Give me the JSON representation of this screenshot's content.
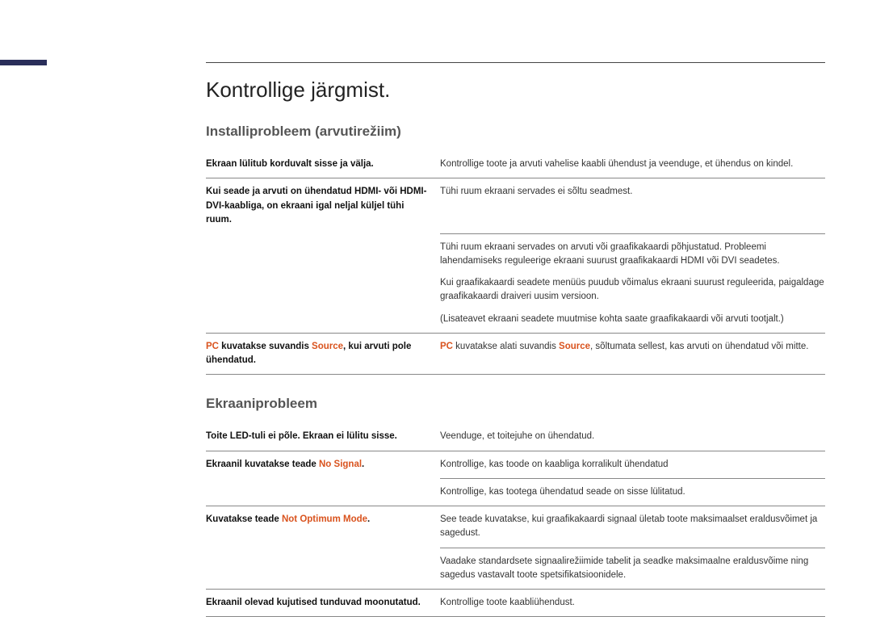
{
  "title": "Kontrollige järgmist.",
  "sections": [
    {
      "heading": "Installiprobleem (arvutirežiim)",
      "rows": [
        {
          "left_plain": "Ekraan lülitub korduvalt sisse ja välja.",
          "right_plain": "Kontrollige toote ja arvuti vahelise kaabli ühendust ja veenduge, et ühendus on kindel.",
          "sep": "both"
        },
        {
          "left_plain": "Kui seade ja arvuti on ühendatud HDMI- või HDMI-DVI-kaabliga, on ekraani igal neljal küljel tühi ruum.",
          "right_plain": "Tühi ruum ekraani servades ei sõltu seadmest.",
          "sep": "right"
        },
        {
          "left_plain": "",
          "right_paras": [
            "Tühi ruum ekraani servades on arvuti või graafikakaardi põhjustatud. Probleemi lahendamiseks reguleerige ekraani suurust graafikakaardi HDMI või DVI seadetes.",
            "Kui graafikakaardi seadete menüüs puudub võimalus ekraani suurust reguleerida, paigaldage graafikakaardi draiveri uusim versioon.",
            "(Lisateavet ekraani seadete muutmise kohta saate graafikakaardi või arvuti tootjalt.)"
          ],
          "sep": "both"
        },
        {
          "left_parts": [
            {
              "t": "PC",
              "hl": true
            },
            {
              "t": " kuvatakse suvandis "
            },
            {
              "t": "Source",
              "hl": true
            },
            {
              "t": ", kui arvuti pole ühendatud."
            }
          ],
          "right_parts": [
            {
              "t": "PC",
              "hl": true
            },
            {
              "t": " kuvatakse alati suvandis "
            },
            {
              "t": "Source",
              "hl": true
            },
            {
              "t": ", sõltumata sellest, kas arvuti on ühendatud või mitte."
            }
          ],
          "sep": "both"
        }
      ]
    },
    {
      "heading": "Ekraaniprobleem",
      "rows": [
        {
          "left_plain": "Toite LED-tuli ei põle. Ekraan ei lülitu sisse.",
          "right_plain": "Veenduge, et toitejuhe on ühendatud.",
          "sep": "both"
        },
        {
          "left_parts": [
            {
              "t": "Ekraanil kuvatakse teade "
            },
            {
              "t": "No Signal",
              "hl": true
            },
            {
              "t": "."
            }
          ],
          "right_plain": "Kontrollige, kas toode on kaabliga korralikult ühendatud",
          "sep": "right"
        },
        {
          "left_plain": "",
          "right_plain": "Kontrollige, kas tootega ühendatud seade on sisse lülitatud.",
          "sep": "both"
        },
        {
          "left_parts": [
            {
              "t": "Kuvatakse teade "
            },
            {
              "t": "Not Optimum Mode",
              "hl": true
            },
            {
              "t": "."
            }
          ],
          "right_plain": "See teade kuvatakse, kui graafikakaardi signaal ületab toote maksimaalset eraldusvõimet ja sagedust.",
          "sep": "right"
        },
        {
          "left_plain": "",
          "right_plain": "Vaadake standardsete signaalirežiimide tabelit ja seadke maksimaalne eraldusvõime ning sagedus vastavalt toote spetsifikatsioonidele.",
          "sep": "both"
        },
        {
          "left_plain": "Ekraanil olevad kujutised tunduvad moonutatud.",
          "right_plain": "Kontrollige toote kaabliühendust.",
          "sep": "both"
        }
      ]
    }
  ]
}
